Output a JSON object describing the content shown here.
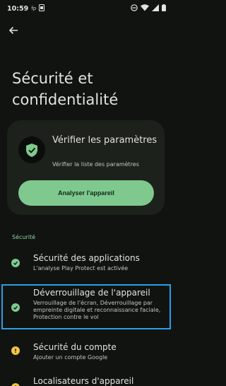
{
  "status": {
    "time": "10:59",
    "fp": "fp",
    "icons": [
      "do-not-disturb-icon",
      "wifi-icon",
      "signal-icon",
      "battery-icon"
    ]
  },
  "page": {
    "title": "Sécurité et confidentialité"
  },
  "card": {
    "title": "Vérifier les paramètres",
    "subtitle": "Vérifier la liste des paramètres",
    "button": "Analyser l'appareil"
  },
  "section": {
    "label": "Sécurité"
  },
  "items": [
    {
      "title": "Sécurité des applications",
      "subtitle": "L'analyse Play Protect est activée",
      "status": "ok"
    },
    {
      "title": "Déverrouillage de l'appareil",
      "subtitle": "Verrouillage de l'écran, Déverrouillage par empreinte digitale et reconnaissance faciale, Protection contre le vol",
      "status": "ok"
    },
    {
      "title": "Sécurité du compte",
      "subtitle": "Ajouter un compte Google",
      "status": "warning"
    },
    {
      "title": "Localisateurs d'appareil",
      "subtitle": "",
      "status": "warning"
    }
  ],
  "colors": {
    "ok": "#7fc98f",
    "warning": "#f4c542",
    "accent": "#8fd6a0"
  }
}
